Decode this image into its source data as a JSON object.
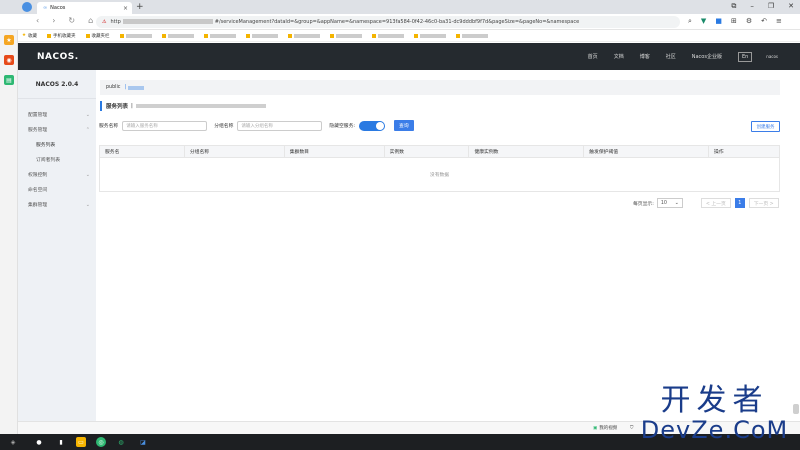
{
  "browser": {
    "tab_title": "Nacos",
    "tab_favicon": "∞",
    "url_visible_start": "http",
    "url_visible_text": "#/serviceManagement?dataId=&group=&appName=&namespace=913fa584-0f42-46c0-ba31-dc9dddbf9f7d&pageSize=&pageNo=&namespace",
    "bookmarks": [
      {
        "label": "收藏"
      },
      {
        "label": "手机收藏夹"
      },
      {
        "label": "收藏夹栏"
      }
    ]
  },
  "header": {
    "logo": "NACOS.",
    "nav": [
      "首页",
      "文档",
      "博客",
      "社区",
      "Nacos企业版"
    ],
    "lang": "En",
    "user": "nacos"
  },
  "sidebar": {
    "version": "NACOS 2.0.4",
    "items": [
      {
        "label": "配置管理",
        "chev": "⌄"
      },
      {
        "label": "服务管理",
        "chev": "⌃"
      },
      {
        "label": "服务列表",
        "chev": ""
      },
      {
        "label": "订阅者列表",
        "chev": ""
      },
      {
        "label": "权限控制",
        "chev": "⌄"
      },
      {
        "label": "命名空间",
        "chev": ""
      },
      {
        "label": "集群管理",
        "chev": "⌄"
      }
    ]
  },
  "main": {
    "breadcrumb": {
      "root": "public",
      "sep": "|"
    },
    "page_title": "服务列表",
    "page_title_sep": "|",
    "filters": {
      "service_name_label": "服务名称",
      "service_name_placeholder": "请输入服务名称",
      "group_name_label": "分组名称",
      "group_name_placeholder": "请输入分组名称",
      "hide_empty_label": "隐藏空服务:",
      "query_button": "查询"
    },
    "create_button": "创建服务",
    "table": {
      "columns": [
        "服务名",
        "分组名称",
        "集群数目",
        "实例数",
        "健康实例数",
        "触发保护阈值",
        "操作"
      ],
      "empty_text": "没有数据"
    },
    "pagination": {
      "page_size_label": "每页显示:",
      "page_size_value": "10",
      "prev_label": "< 上一页",
      "current_page": "1",
      "next_label": "下一页 >"
    }
  },
  "statusbar": {
    "video_label": "我的视频"
  },
  "watermark": {
    "line1": "开发者",
    "line2": "DevZe.CoM"
  }
}
